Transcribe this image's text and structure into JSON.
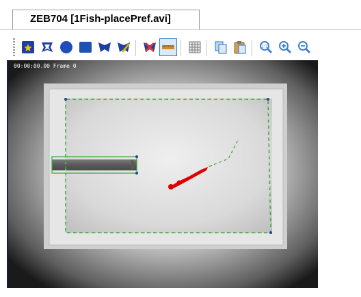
{
  "tab": {
    "title": "ZEB704 [1Fish-placePref.avi]"
  },
  "toolbar": {
    "buttons": [
      {
        "icon": "select-arena-icon",
        "color": "#1f4fb8"
      },
      {
        "icon": "polygon-zone-icon",
        "color": "#1f3f9e"
      },
      {
        "icon": "circle-zone-icon",
        "color": "#1f4fb8"
      },
      {
        "icon": "rectangle-zone-icon",
        "color": "#1f4fb8"
      },
      {
        "icon": "freehand-zone-icon",
        "color": "#1f3f9e"
      },
      {
        "icon": "erase-zone-icon",
        "color": "#e3b200"
      },
      {
        "icon": "delete-zone-icon",
        "color": "#d23a3a"
      },
      {
        "icon": "ruler-icon",
        "color": "#d08a2a"
      },
      {
        "icon": "grid-icon",
        "color": "#7a7a7a"
      },
      {
        "icon": "copy-icon",
        "color": "#2f72c8"
      },
      {
        "icon": "paste-icon",
        "color": "#2f72c8"
      },
      {
        "icon": "zoom-fit-icon",
        "color": "#3f7fd0"
      },
      {
        "icon": "zoom-in-icon",
        "color": "#3f7fd0"
      },
      {
        "icon": "zoom-out-icon",
        "color": "#3f7fd0"
      }
    ],
    "active_tool": "ruler-icon"
  },
  "video": {
    "overlay_text": "00:00:00.00 Frame 0",
    "zone_line_color": "#3aa33a",
    "track_color": "#e00000"
  }
}
